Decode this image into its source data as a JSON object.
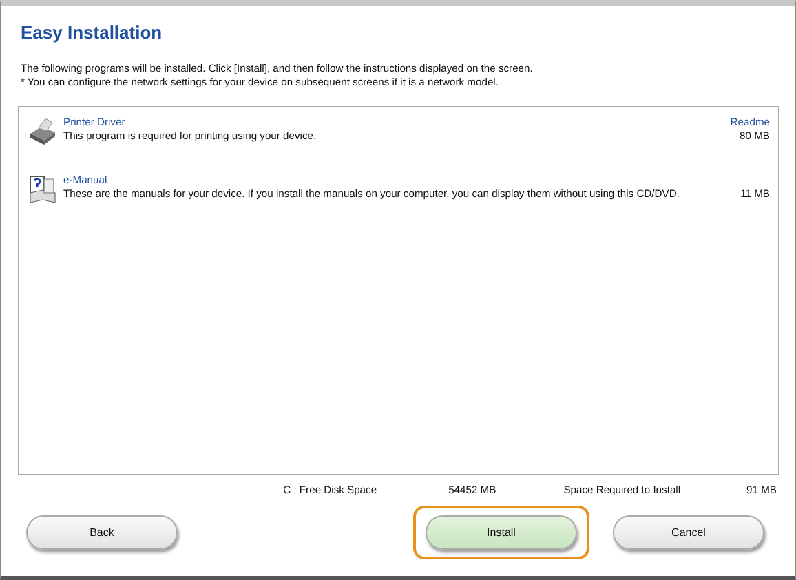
{
  "window": {
    "title": "Easy Installation"
  },
  "intro": [
    "The following programs will be installed. Click [Install], and then follow the instructions displayed on the screen.",
    "* You can configure the network settings for your device on subsequent screens if it is a network model."
  ],
  "programs": [
    {
      "kind": "printer",
      "name": "Printer Driver",
      "description": "This program is required for printing using your device.",
      "link": "Readme",
      "size": "80 MB"
    },
    {
      "kind": "manual",
      "name": "e-Manual",
      "description": "These are the manuals for your device. If you install the manuals on your computer, you can display them without using this CD/DVD.",
      "size": "11 MB"
    }
  ],
  "disk": {
    "label": "C : Free Disk Space",
    "free": "54452 MB",
    "required_label": "Space Required to Install",
    "required": "91 MB"
  },
  "buttons": [
    {
      "label": "Back",
      "highlighted": false
    },
    {
      "label": "Install",
      "highlighted": true
    },
    {
      "label": "Cancel",
      "highlighted": false
    }
  ]
}
